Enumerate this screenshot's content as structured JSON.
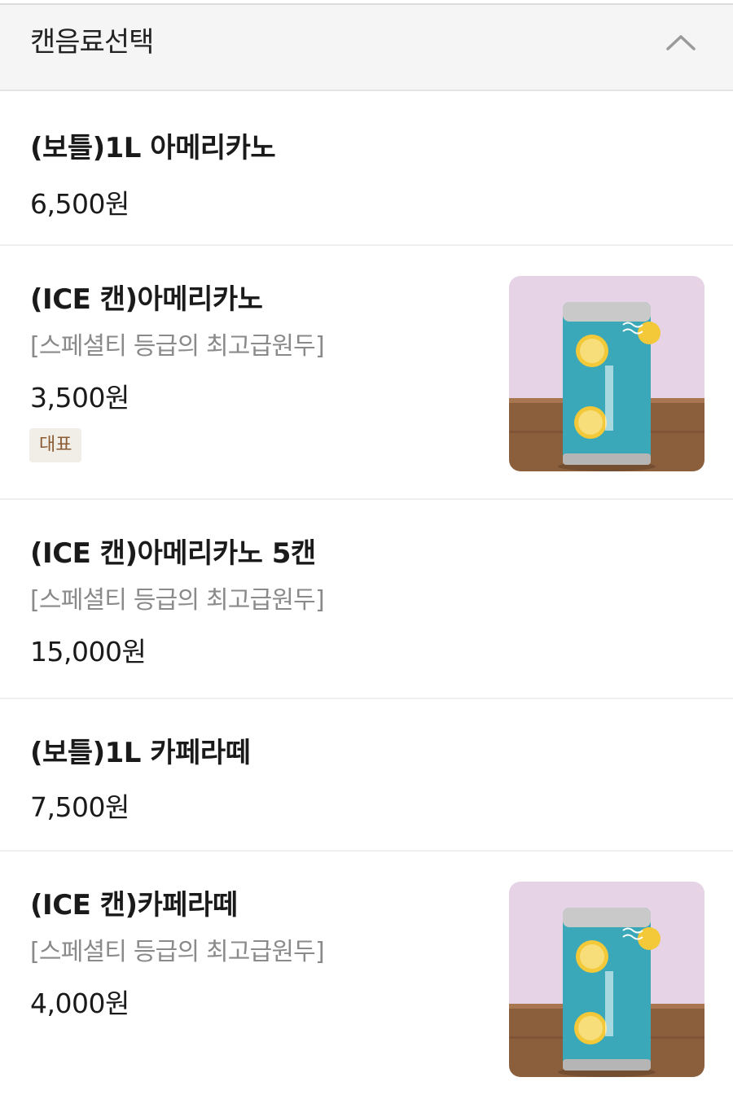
{
  "section": {
    "title": "캔음료선택",
    "toggle_icon": "chevron-up-icon"
  },
  "items": [
    {
      "name": "(보틀)1L 아메리카노",
      "description": "",
      "price": "6,500원",
      "badge": "",
      "has_image": false
    },
    {
      "name": "(ICE 캔)아메리카노",
      "description": "[스페셜티 등급의 최고급원두]",
      "price": "3,500원",
      "badge": "대표",
      "has_image": true
    },
    {
      "name": "(ICE 캔)아메리카노 5캔",
      "description": "[스페셜티 등급의 최고급원두]",
      "price": "15,000원",
      "badge": "",
      "has_image": false
    },
    {
      "name": "(보틀)1L 카페라떼",
      "description": "",
      "price": "7,500원",
      "badge": "",
      "has_image": false
    },
    {
      "name": "(ICE 캔)카페라떼",
      "description": "[스페셜티 등급의 최고급원두]",
      "price": "4,000원",
      "badge": "",
      "has_image": true
    }
  ],
  "colors": {
    "header_bg": "#f5f5f5",
    "badge_bg": "#f1ede7",
    "badge_text": "#8a5a32",
    "description_text": "#8a8a8a",
    "can_teal": "#3aa8b8",
    "thumb_wall": "#e6d3e6",
    "thumb_table": "#8b5e3c"
  }
}
